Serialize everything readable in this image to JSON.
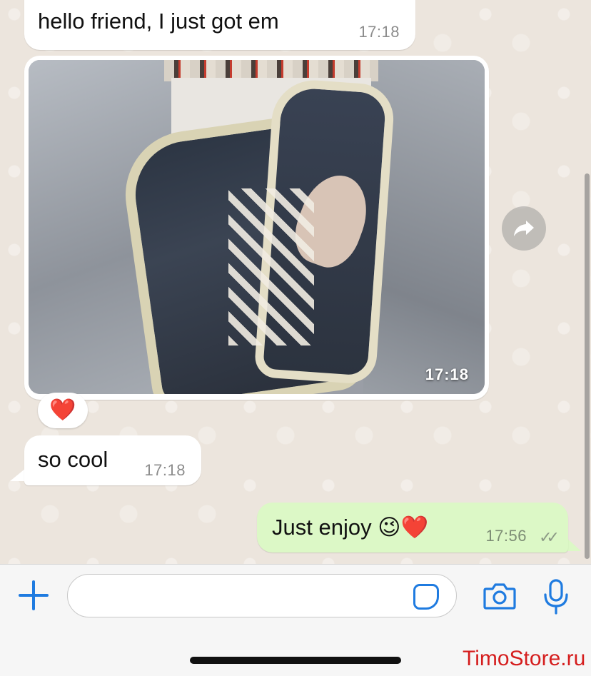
{
  "messages": [
    {
      "direction": "incoming",
      "text": "hello friend, I just got em",
      "time": "17:18"
    },
    {
      "direction": "incoming",
      "type": "image",
      "time": "17:18",
      "reaction": "❤️"
    },
    {
      "direction": "incoming",
      "text": "so cool",
      "time": "17:18"
    },
    {
      "direction": "outgoing",
      "text": "Just enjoy 😉❤️",
      "time": "17:56",
      "status": "read"
    }
  ],
  "input": {
    "placeholder": "",
    "value": ""
  },
  "icons": {
    "attach": "plus-icon",
    "sticker": "sticker-icon",
    "camera": "camera-icon",
    "mic": "microphone-icon",
    "forward": "forward-arrow-icon",
    "read_ticks": "double-check-icon"
  },
  "colors": {
    "accent": "#1f7be0",
    "incoming_bubble": "#ffffff",
    "outgoing_bubble": "#dcf8c6",
    "chat_background": "#ece5dd",
    "watermark": "#d51d1d"
  },
  "watermark": "TimoStore.ru"
}
